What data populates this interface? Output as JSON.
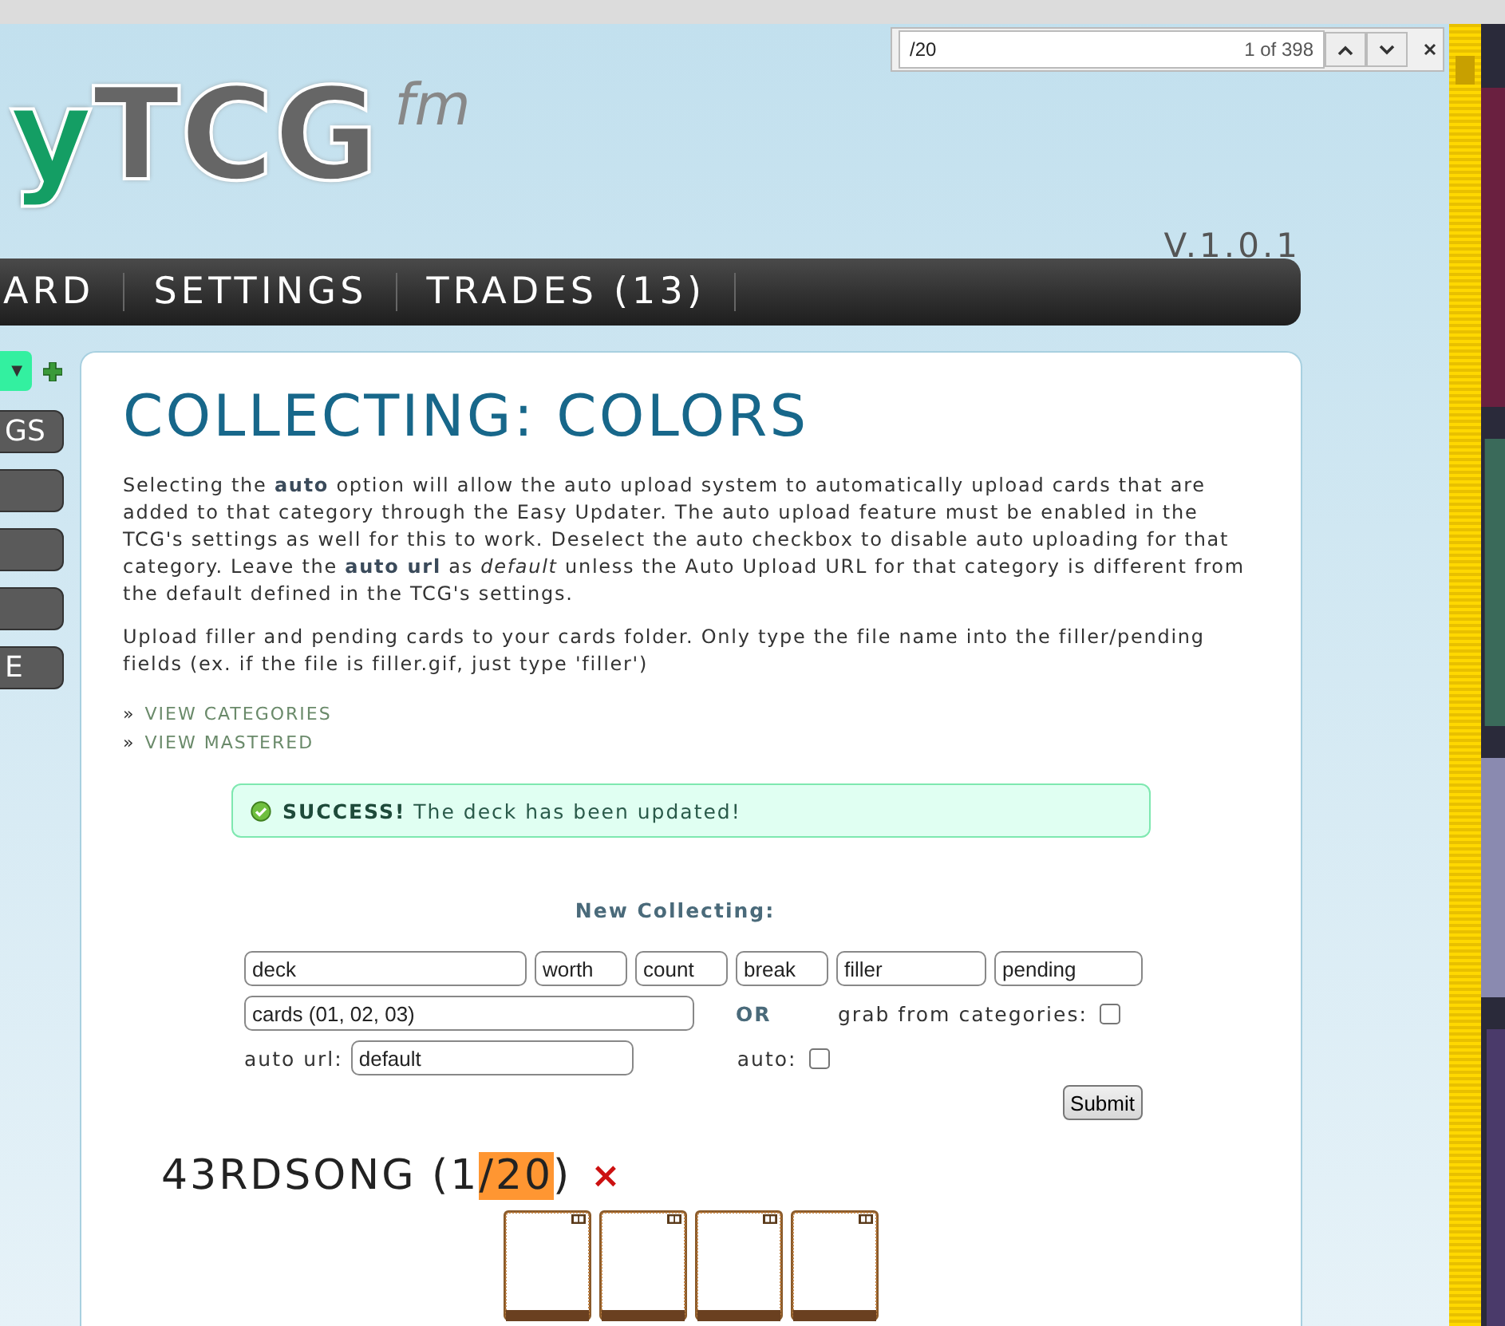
{
  "find_bar": {
    "query": "/20",
    "count": "1 of 398"
  },
  "header": {
    "logo": {
      "accent": "y",
      "main": "TCG",
      "suffix": "fm"
    },
    "version": "V.1.0.1"
  },
  "nav": [
    "ARD",
    "SETTINGS",
    "TRADES (13)"
  ],
  "sidebar": {
    "select_arrow": "▼",
    "buttons": [
      {
        "kind": "text",
        "label": "GS"
      },
      {
        "kind": "blank"
      },
      {
        "kind": "blank"
      },
      {
        "kind": "blank"
      },
      {
        "kind": "text",
        "label": "E"
      }
    ]
  },
  "content": {
    "title": "COLLECTING: COLORS",
    "paragraphs": [
      "Selecting the **auto** option will allow the auto upload system to automatically upload cards that are added to that category through the Easy Updater. The auto upload feature must be enabled in the TCG's settings as well for this to work. Deselect the auto checkbox to disable auto uploading for that category. Leave the **auto url** as *default* unless the Auto Upload URL for that category is different from the default defined in the TCG's settings.",
      "Upload filler and pending cards to your cards folder. Only type the file name into the filler/pending fields (ex. if the file is filler.gif, just type 'filler')"
    ],
    "links": [
      {
        "marker": "»",
        "label": "VIEW CATEGORIES"
      },
      {
        "marker": "»",
        "label": "VIEW MASTERED"
      }
    ],
    "alert": {
      "strong": "SUCCESS!",
      "text": "The deck has been updated!"
    },
    "form": {
      "heading": "New Collecting:",
      "fields": [
        {
          "value": "deck"
        },
        {
          "value": "worth"
        },
        {
          "value": "count"
        },
        {
          "value": "break"
        },
        {
          "value": "filler"
        },
        {
          "value": "pending"
        }
      ],
      "cards_value": "cards (01, 02, 03)",
      "or_label": "OR",
      "grab_label": "grab from categories:",
      "grab_checked": false,
      "auto_url_label": "auto url:",
      "auto_url_value": "default",
      "auto_label": "auto:",
      "auto_checked": false,
      "submit": "Submit"
    },
    "deck": {
      "before": "43RDSONG (1",
      "match": "/20",
      "after": ")",
      "delete": "×"
    }
  }
}
